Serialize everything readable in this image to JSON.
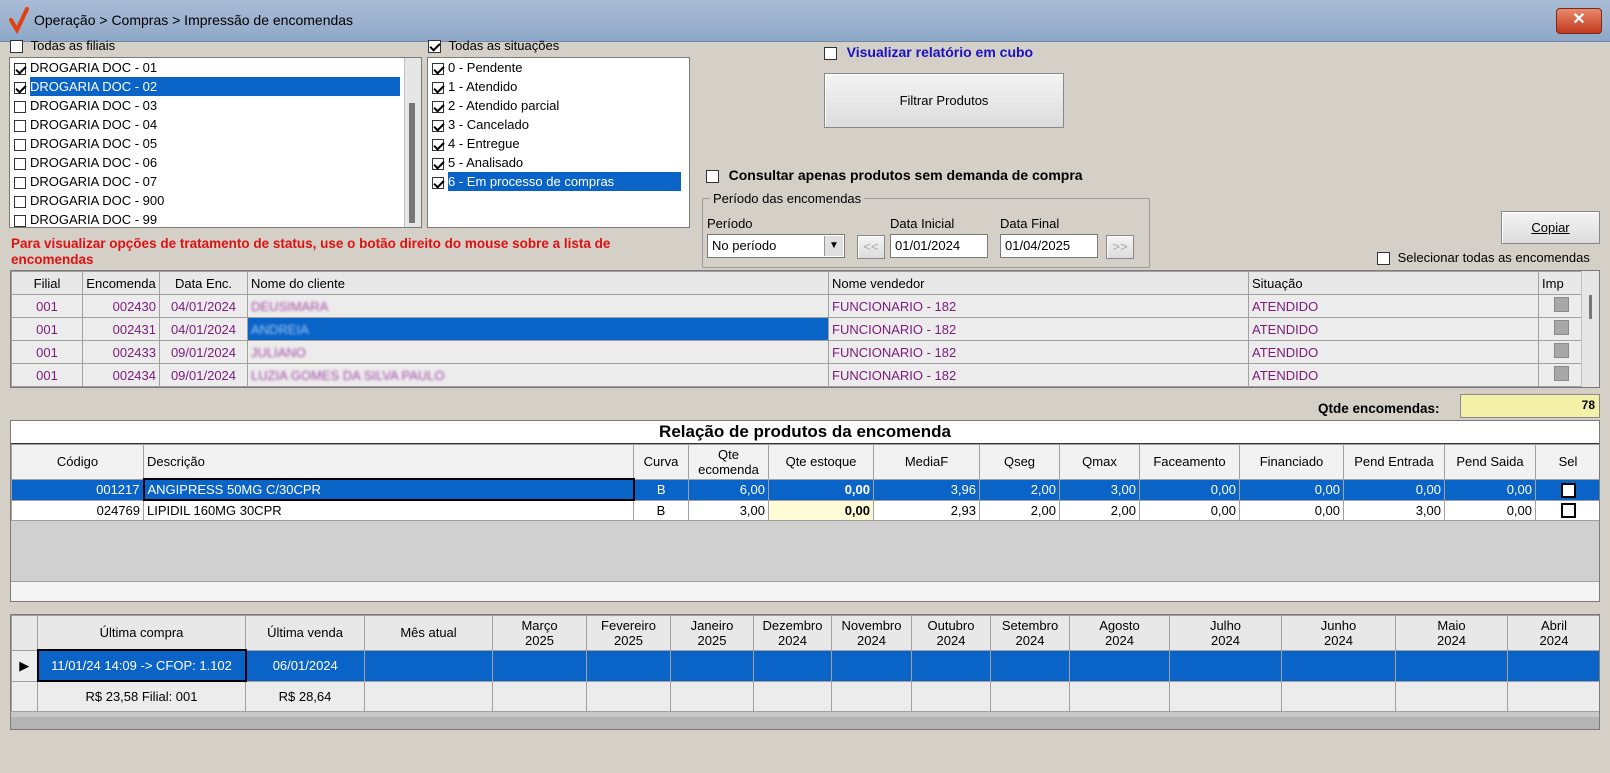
{
  "window": {
    "title": "Operação > Compras > Impressão de encomendas",
    "close_label": "✕"
  },
  "filiais": {
    "all_label": "Todas as filiais",
    "all_checked": false,
    "items": [
      {
        "label": "DROGARIA DOC - 01",
        "checked": true
      },
      {
        "label": "DROGARIA DOC - 02",
        "checked": true
      },
      {
        "label": "DROGARIA DOC - 03",
        "checked": false
      },
      {
        "label": "DROGARIA DOC - 04",
        "checked": false
      },
      {
        "label": "DROGARIA DOC - 05",
        "checked": false
      },
      {
        "label": "DROGARIA DOC - 06",
        "checked": false
      },
      {
        "label": "DROGARIA DOC - 07",
        "checked": false
      },
      {
        "label": "DROGARIA DOC - 900",
        "checked": false
      },
      {
        "label": "DROGARIA DOC - 99",
        "checked": false
      }
    ]
  },
  "situacoes": {
    "all_label": "Todas as situações",
    "all_checked": true,
    "items": [
      {
        "label": "0 - Pendente",
        "checked": true
      },
      {
        "label": "1 - Atendido",
        "checked": true
      },
      {
        "label": "2 - Atendido parcial",
        "checked": true
      },
      {
        "label": "3 - Cancelado",
        "checked": true
      },
      {
        "label": "4 - Entregue",
        "checked": true
      },
      {
        "label": "5 - Analisado",
        "checked": true
      },
      {
        "label": "6 - Em processo de compras",
        "checked": true
      }
    ]
  },
  "options": {
    "cubo_label": "Visualizar relatório em cubo",
    "filtrar_label": "Filtrar Produtos",
    "sem_demanda_label": "Consultar apenas produtos sem demanda de compra"
  },
  "periodo": {
    "group_label": "Período das encomendas",
    "periodo_label": "Período",
    "periodo_value": "No período",
    "data_inicial_label": "Data Inicial",
    "data_inicial": "01/01/2024",
    "data_final_label": "Data Final",
    "data_final": "01/04/2025",
    "prev": "<<",
    "next": ">>"
  },
  "copiar_label": "Copiar",
  "selecionar_todas_label": "Selecionar todas as encomendas",
  "status_hint": "Para visualizar opções de tratamento de status, use o botão direito do mouse sobre a lista de encomendas",
  "encomendas": {
    "headers": [
      "Filial",
      "Encomenda",
      "Data Enc.",
      "Nome do cliente",
      "Nome vendedor",
      "Situação",
      "Imp"
    ],
    "rows": [
      {
        "filial": "001",
        "encomenda": "002430",
        "data": "04/01/2024",
        "cliente": "DEUSIMARA",
        "vendedor": "FUNCIONARIO - 182",
        "situacao": "ATENDIDO"
      },
      {
        "filial": "001",
        "encomenda": "002431",
        "data": "04/01/2024",
        "cliente": "ANDREIA",
        "vendedor": "FUNCIONARIO - 182",
        "situacao": "ATENDIDO"
      },
      {
        "filial": "001",
        "encomenda": "002433",
        "data": "09/01/2024",
        "cliente": "JULIANO",
        "vendedor": "FUNCIONARIO - 182",
        "situacao": "ATENDIDO"
      },
      {
        "filial": "001",
        "encomenda": "002434",
        "data": "09/01/2024",
        "cliente": "LUZIA GOMES DA SILVA PAULO",
        "vendedor": "FUNCIONARIO - 182",
        "situacao": "ATENDIDO"
      }
    ]
  },
  "qtde_encomendas": {
    "label": "Qtde encomendas:",
    "value": "78"
  },
  "produtos": {
    "title": "Relação de produtos da encomenda",
    "headers": [
      "Código",
      "Descrição",
      "Curva",
      "Qte ecomenda",
      "Qte estoque",
      "MediaF",
      "Qseg",
      "Qmax",
      "Faceamento",
      "Financiado",
      "Pend Entrada",
      "Pend Saida",
      "Sel"
    ],
    "rows": [
      {
        "codigo": "001217",
        "descricao": "ANGIPRESS 50MG C/30CPR",
        "curva": "B",
        "qte_encomenda": "6,00",
        "qte_estoque": "0,00",
        "mediaf": "3,96",
        "qseg": "2,00",
        "qmax": "3,00",
        "faceamento": "0,00",
        "financiado": "0,00",
        "pend_entrada": "0,00",
        "pend_saida": "0,00"
      },
      {
        "codigo": "024769",
        "descricao": "LIPIDIL 160MG 30CPR",
        "curva": "B",
        "qte_encomenda": "3,00",
        "qte_estoque": "0,00",
        "mediaf": "2,93",
        "qseg": "2,00",
        "qmax": "2,00",
        "faceamento": "0,00",
        "financiado": "0,00",
        "pend_entrada": "3,00",
        "pend_saida": "0,00"
      }
    ]
  },
  "historico": {
    "headers": [
      "Última compra",
      "Última venda",
      "Mês atual",
      "Março\n2025",
      "Fevereiro\n2025",
      "Janeiro\n2025",
      "Dezembro\n2024",
      "Novembro\n2024",
      "Outubro\n2024",
      "Setembro\n2024",
      "Agosto\n2024",
      "Julho\n2024",
      "Junho\n2024",
      "Maio\n2024",
      "Abril\n2024"
    ],
    "row1": {
      "ultima_compra": "11/01/24 14:09 -> CFOP: 1.102",
      "ultima_venda": "06/01/2024"
    },
    "row2": {
      "ultima_compra": "R$ 23,58 Filial: 001",
      "ultima_venda": "R$ 28,64"
    }
  },
  "colors": {
    "selection": "#0a64c8",
    "status_red": "#e01010",
    "vendor_purple": "#7a1b7a"
  }
}
